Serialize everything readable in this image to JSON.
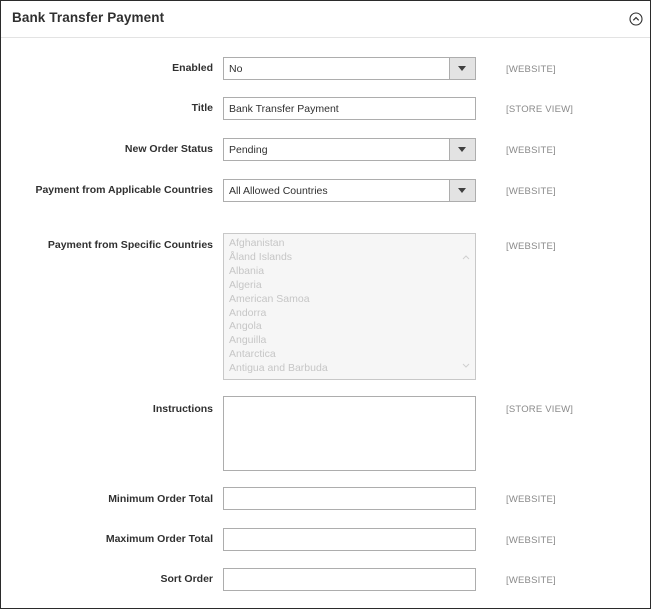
{
  "section": {
    "title": "Bank Transfer Payment",
    "collapse_icon": "chevron-up-circle-icon"
  },
  "fields": {
    "enabled": {
      "label": "Enabled",
      "value": "No",
      "scope": "[WEBSITE]"
    },
    "title": {
      "label": "Title",
      "value": "Bank Transfer Payment",
      "scope": "[STORE VIEW]"
    },
    "new_order_status": {
      "label": "New Order Status",
      "value": "Pending",
      "scope": "[WEBSITE]"
    },
    "applicable_countries": {
      "label": "Payment from Applicable Countries",
      "value": "All Allowed Countries",
      "scope": "[WEBSITE]"
    },
    "specific_countries": {
      "label": "Payment from Specific Countries",
      "scope": "[WEBSITE]",
      "options": [
        "Afghanistan",
        "Åland Islands",
        "Albania",
        "Algeria",
        "American Samoa",
        "Andorra",
        "Angola",
        "Anguilla",
        "Antarctica",
        "Antigua and Barbuda"
      ],
      "disabled": true
    },
    "instructions": {
      "label": "Instructions",
      "value": "",
      "scope": "[STORE VIEW]"
    },
    "min_order_total": {
      "label": "Minimum Order Total",
      "value": "",
      "scope": "[WEBSITE]"
    },
    "max_order_total": {
      "label": "Maximum Order Total",
      "value": "",
      "scope": "[WEBSITE]"
    },
    "sort_order": {
      "label": "Sort Order",
      "value": "",
      "scope": "[WEBSITE]"
    }
  },
  "colors": {
    "border": "#adadad",
    "label_text": "#303030",
    "scope_text": "#8a8a8a",
    "disabled_bg": "#f6f6f6",
    "disabled_text": "#c6c6c6",
    "select_button_bg": "#e3e3e3"
  }
}
